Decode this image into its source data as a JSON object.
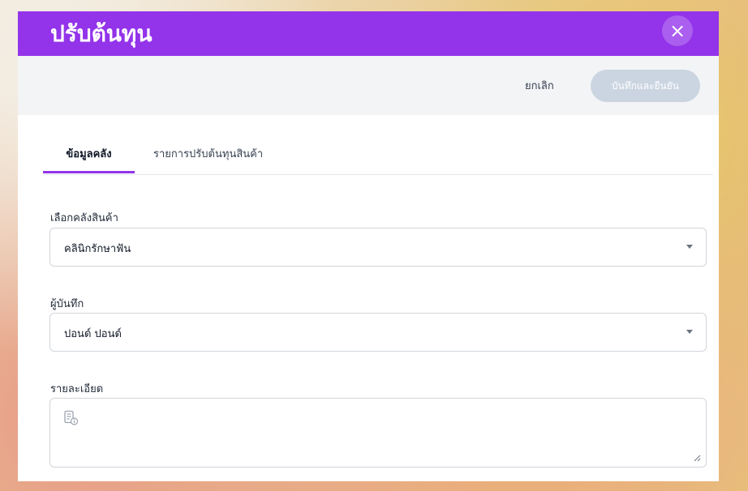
{
  "modal": {
    "title": "ปรับต้นทุน",
    "close_symbol": "×"
  },
  "actions": {
    "cancel_label": "ยกเลิก",
    "confirm_label": "บันทึกและยืนยัน"
  },
  "tabs": [
    {
      "label": "ข้อมูลคลัง",
      "active": true
    },
    {
      "label": "รายการปรับต้นทุนสินค้า",
      "active": false
    }
  ],
  "form": {
    "warehouse": {
      "label": "เลือกคลังสินค้า",
      "value": "คลินิกรักษาฟัน"
    },
    "recorder": {
      "label": "ผู้บันทึก",
      "value": "ปอนด์ ปอนด์"
    },
    "details": {
      "label": "รายละเอียด",
      "value": ""
    }
  },
  "colors": {
    "header": "#9333ea",
    "tab_indicator": "#9333ea",
    "confirm_disabled": "#cbd5e1"
  }
}
